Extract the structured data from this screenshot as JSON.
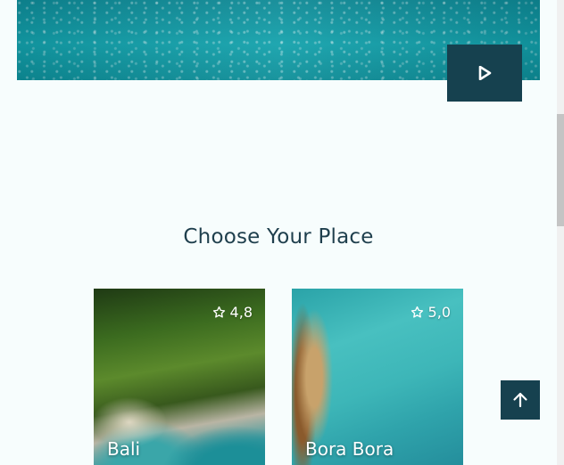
{
  "section": {
    "title": "Choose Your Place"
  },
  "places": [
    {
      "name": "Bali",
      "rating": "4,8"
    },
    {
      "name": "Bora Bora",
      "rating": "5,0"
    }
  ],
  "icons": {
    "play": "play-icon",
    "star": "star-outline-icon",
    "back_to_top": "arrow-up-icon"
  },
  "colors": {
    "accent": "#16414f",
    "title": "#1f3f4d",
    "background": "#f7fdfd"
  }
}
